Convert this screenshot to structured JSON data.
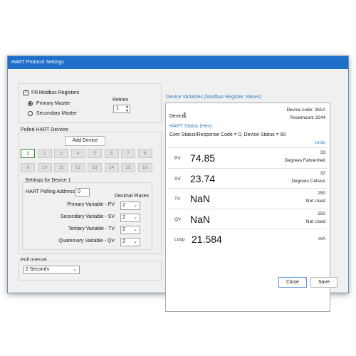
{
  "window": {
    "title": "HART Protocol Settings"
  },
  "modbus": {
    "fill_label": "Fill Modbus Registers",
    "primary_label": "Primary Master",
    "secondary_label": "Secondary Master",
    "retries_label": "Retries",
    "retries_value": "1"
  },
  "polled": {
    "title": "Polled HART Devices",
    "add_button": "Add Device",
    "devices": [
      "1",
      "2",
      "3",
      "4",
      "5",
      "6",
      "7",
      "8",
      "9",
      "10",
      "11",
      "12",
      "13",
      "14",
      "15",
      "16"
    ],
    "selected": "1"
  },
  "settings": {
    "title": "Settings for Device 1",
    "polling_label": "HART Polling Address",
    "polling_value": "0",
    "decimal_label": "Decimal Places",
    "vars": [
      {
        "label": "Primary Variable - PV",
        "value": "2"
      },
      {
        "label": "Secondary Variable - SV",
        "value": "2"
      },
      {
        "label": "Tertiary Variable - TV",
        "value": "2"
      },
      {
        "label": "Quaternary Variable - QV",
        "value": "2"
      }
    ]
  },
  "poll": {
    "title": "Poll Interval",
    "value": "2 Seconds"
  },
  "device_vars": {
    "title": "Device Variables (Modbus Register Values)",
    "device_label": "Device",
    "device_num": "1",
    "device_code": "Device code: 261A",
    "manufacturer": "Rosemount 3244",
    "hart_status": "HART Status (Hex)",
    "com_status": "Com Status/Response Code = 0, Device Status = 60",
    "units_header": "Units",
    "rows": [
      {
        "label": "PV",
        "value": "74.85",
        "code": "33",
        "unit": "Degrees Fahrenheit"
      },
      {
        "label": "SV",
        "value": "23.74",
        "code": "32",
        "unit": "Degrees Celsius"
      },
      {
        "label": "TV",
        "value": "NaN",
        "code": "250",
        "unit": "Not Used"
      },
      {
        "label": "QV",
        "value": "NaN",
        "code": "250",
        "unit": "Not Used"
      },
      {
        "label": "Loop",
        "value": "21.584",
        "code": "",
        "unit": "mA"
      }
    ]
  },
  "footer": {
    "close": "Close",
    "save": "Save"
  }
}
